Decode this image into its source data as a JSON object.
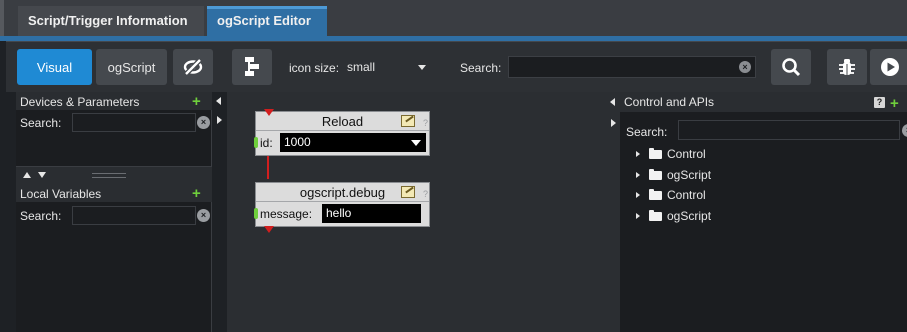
{
  "tabs": [
    {
      "label": "Script/Trigger Information",
      "active": false
    },
    {
      "label": "ogScript Editor",
      "active": true
    }
  ],
  "toolbar": {
    "visual_label": "Visual",
    "ogscript_label": "ogScript",
    "icon_size_label": "icon size:",
    "icon_size_value": "small",
    "search_label": "Search:",
    "search_value": "",
    "accent_color": "#1f8ad4"
  },
  "left_panel": {
    "devices_title": "Devices & Parameters",
    "devices_search_label": "Search:",
    "local_vars_title": "Local Variables",
    "local_vars_search_label": "Search:"
  },
  "canvas": {
    "blocks": [
      {
        "title": "Reload",
        "param_label": "id:",
        "param_value": "1000",
        "is_dropdown": true
      },
      {
        "title": "ogscript.debug",
        "param_label": "message:",
        "param_value": "hello",
        "is_dropdown": false
      }
    ],
    "connector_color": "#d21f1f"
  },
  "right_panel": {
    "title": "Control and APIs",
    "help_label": "?",
    "search_label": "Search:",
    "tree": [
      {
        "label": "Control",
        "icon": "folder-icon"
      },
      {
        "label": "ogScript",
        "icon": "folder-icon"
      },
      {
        "label": "Control",
        "icon": "folder-icon"
      },
      {
        "label": "ogScript",
        "icon": "folder-icon"
      }
    ]
  }
}
